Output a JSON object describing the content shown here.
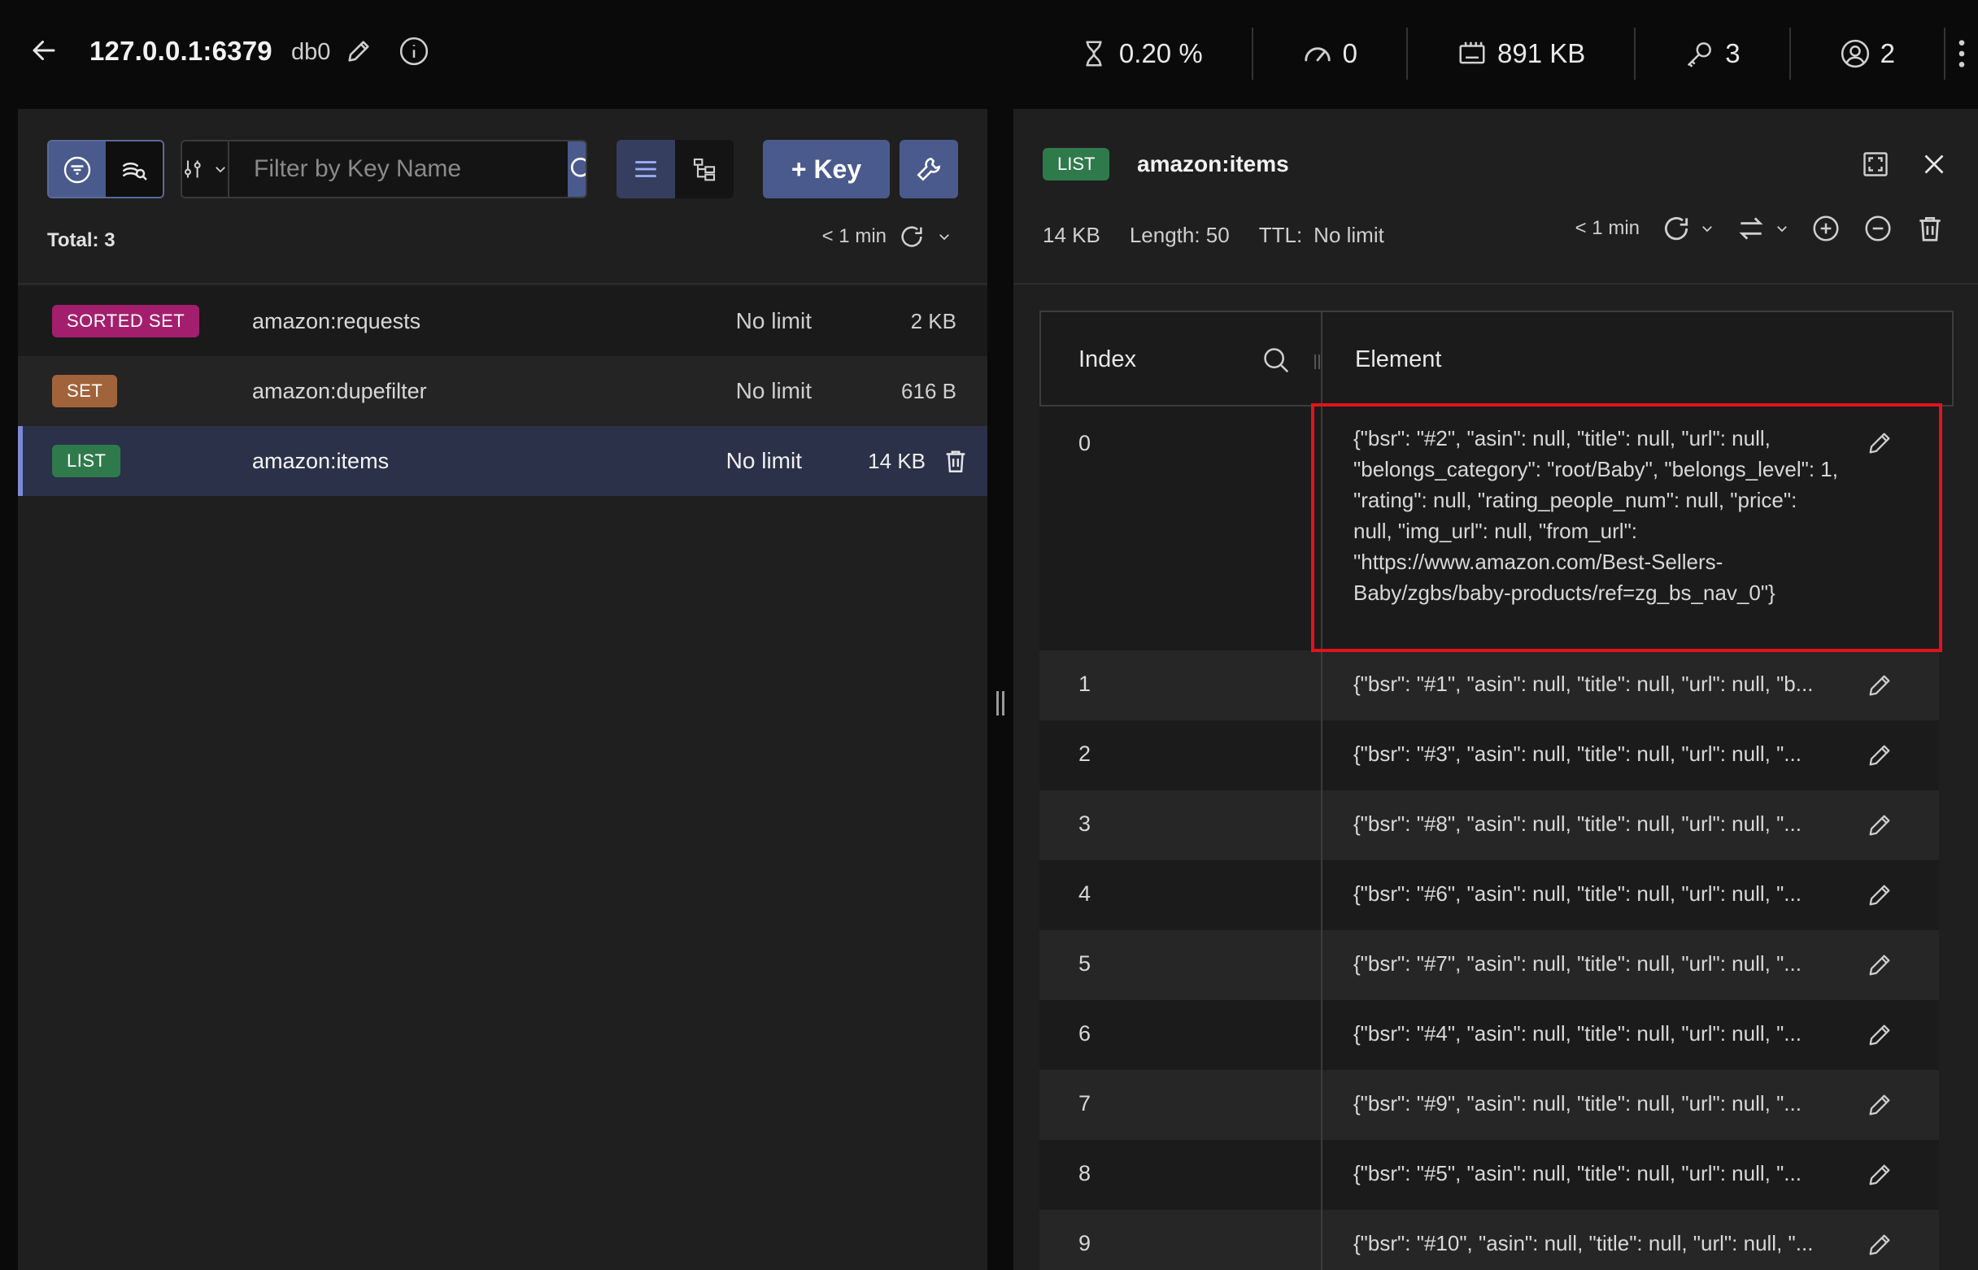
{
  "header": {
    "host": "127.0.0.1:6379",
    "db": "db0",
    "stats": [
      {
        "icon": "cpu-hourglass-icon",
        "value": "0.20 %"
      },
      {
        "icon": "speedometer-icon",
        "value": "0"
      },
      {
        "icon": "memory-icon",
        "value": "891 KB"
      },
      {
        "icon": "key-icon",
        "value": "3"
      },
      {
        "icon": "user-icon",
        "value": "2"
      }
    ]
  },
  "browser": {
    "filter_placeholder": "Filter by Key Name",
    "add_key_label": "+ Key",
    "total_label": "Total: 3",
    "refresh_label": "< 1 min",
    "keys": [
      {
        "type": "SORTED SET",
        "type_color": "#a31f6e",
        "name": "amazon:requests",
        "ttl": "No limit",
        "size": "2 KB"
      },
      {
        "type": "SET",
        "type_color": "#a1633a",
        "name": "amazon:dupefilter",
        "ttl": "No limit",
        "size": "616 B"
      },
      {
        "type": "LIST",
        "type_color": "#2f7a4b",
        "name": "amazon:items",
        "ttl": "No limit",
        "size": "14 KB"
      }
    ]
  },
  "details": {
    "type": "LIST",
    "type_color": "#2f7a4b",
    "key_name": "amazon:items",
    "size": "14 KB",
    "length": "Length: 50",
    "ttl_label": "TTL:",
    "ttl_value": "No limit",
    "refresh_label": "< 1 min",
    "columns": {
      "index": "Index",
      "element": "Element"
    },
    "rows": [
      {
        "index": "0",
        "value": "{\"bsr\": \"#2\", \"asin\": null, \"title\": null, \"url\": null, \"belongs_category\": \"root/Baby\", \"belongs_level\": 1, \"rating\": null, \"rating_people_num\": null, \"price\": null, \"img_url\": null, \"from_url\": \"https://www.amazon.com/Best-Sellers-Baby/zgbs/baby-products/ref=zg_bs_nav_0\"}"
      },
      {
        "index": "1",
        "value": "{\"bsr\": \"#1\", \"asin\": null, \"title\": null, \"url\": null, \"b..."
      },
      {
        "index": "2",
        "value": "{\"bsr\": \"#3\", \"asin\": null, \"title\": null, \"url\": null, \"..."
      },
      {
        "index": "3",
        "value": "{\"bsr\": \"#8\", \"asin\": null, \"title\": null, \"url\": null, \"..."
      },
      {
        "index": "4",
        "value": "{\"bsr\": \"#6\", \"asin\": null, \"title\": null, \"url\": null, \"..."
      },
      {
        "index": "5",
        "value": "{\"bsr\": \"#7\", \"asin\": null, \"title\": null, \"url\": null, \"..."
      },
      {
        "index": "6",
        "value": "{\"bsr\": \"#4\", \"asin\": null, \"title\": null, \"url\": null, \"..."
      },
      {
        "index": "7",
        "value": "{\"bsr\": \"#9\", \"asin\": null, \"title\": null, \"url\": null, \"..."
      },
      {
        "index": "8",
        "value": "{\"bsr\": \"#5\", \"asin\": null, \"title\": null, \"url\": null, \"..."
      },
      {
        "index": "9",
        "value": "{\"bsr\": \"#10\", \"asin\": null, \"title\": null, \"url\": null, \"..."
      }
    ]
  }
}
